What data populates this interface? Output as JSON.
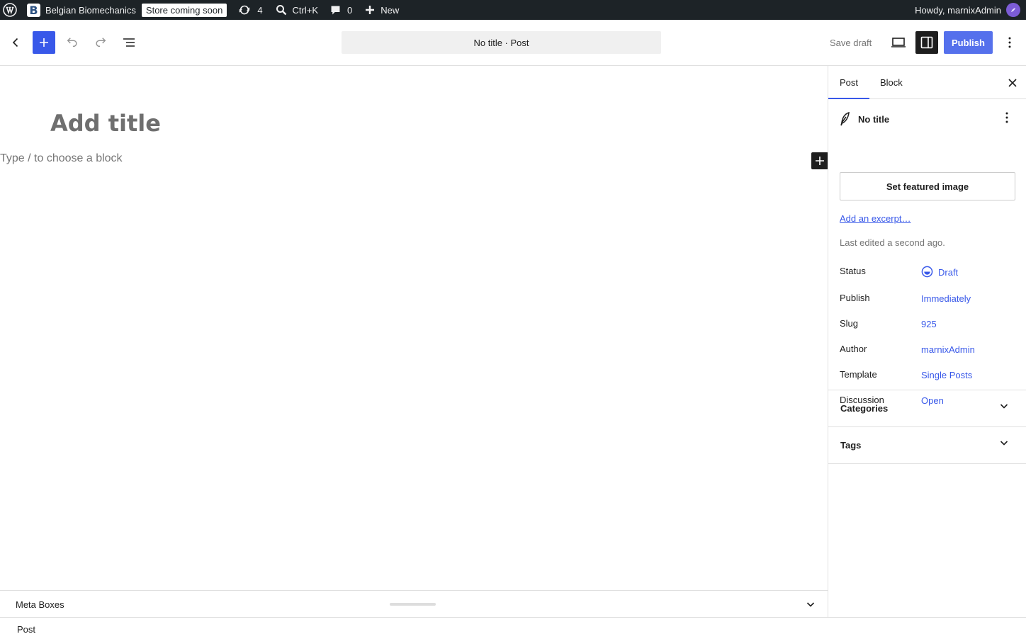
{
  "admin_bar": {
    "site_name": "Belgian Biomechanics",
    "site_logo_letter": "B",
    "store_badge": "Store coming soon",
    "updates_count": "4",
    "search_shortcut": "Ctrl+K",
    "comments_count": "0",
    "new_label": "New",
    "greeting": "Howdy, marnixAdmin"
  },
  "header": {
    "document_title": "No title · Post",
    "save_draft_label": "Save draft",
    "publish_label": "Publish",
    "accent_color": "#3858e9"
  },
  "editor": {
    "title_placeholder": "Add title",
    "block_placeholder": "Type / to choose a block"
  },
  "meta_boxes": {
    "label": "Meta Boxes"
  },
  "footer": {
    "breadcrumb": "Post"
  },
  "sidebar": {
    "tabs": [
      {
        "label": "Post",
        "active": true
      },
      {
        "label": "Block",
        "active": false
      }
    ],
    "post_card": {
      "title": "No title",
      "featured_image_label": "Set featured image",
      "excerpt_link": "Add an excerpt…",
      "last_edited": "Last edited a second ago."
    },
    "summary": [
      {
        "label": "Status",
        "value": "Draft"
      },
      {
        "label": "Publish",
        "value": "Immediately"
      },
      {
        "label": "Slug",
        "value": "925"
      },
      {
        "label": "Author",
        "value": "marnixAdmin"
      },
      {
        "label": "Template",
        "value": "Single Posts"
      },
      {
        "label": "Discussion",
        "value": "Open"
      }
    ],
    "panels": [
      {
        "title": "Categories"
      },
      {
        "title": "Tags"
      }
    ]
  }
}
